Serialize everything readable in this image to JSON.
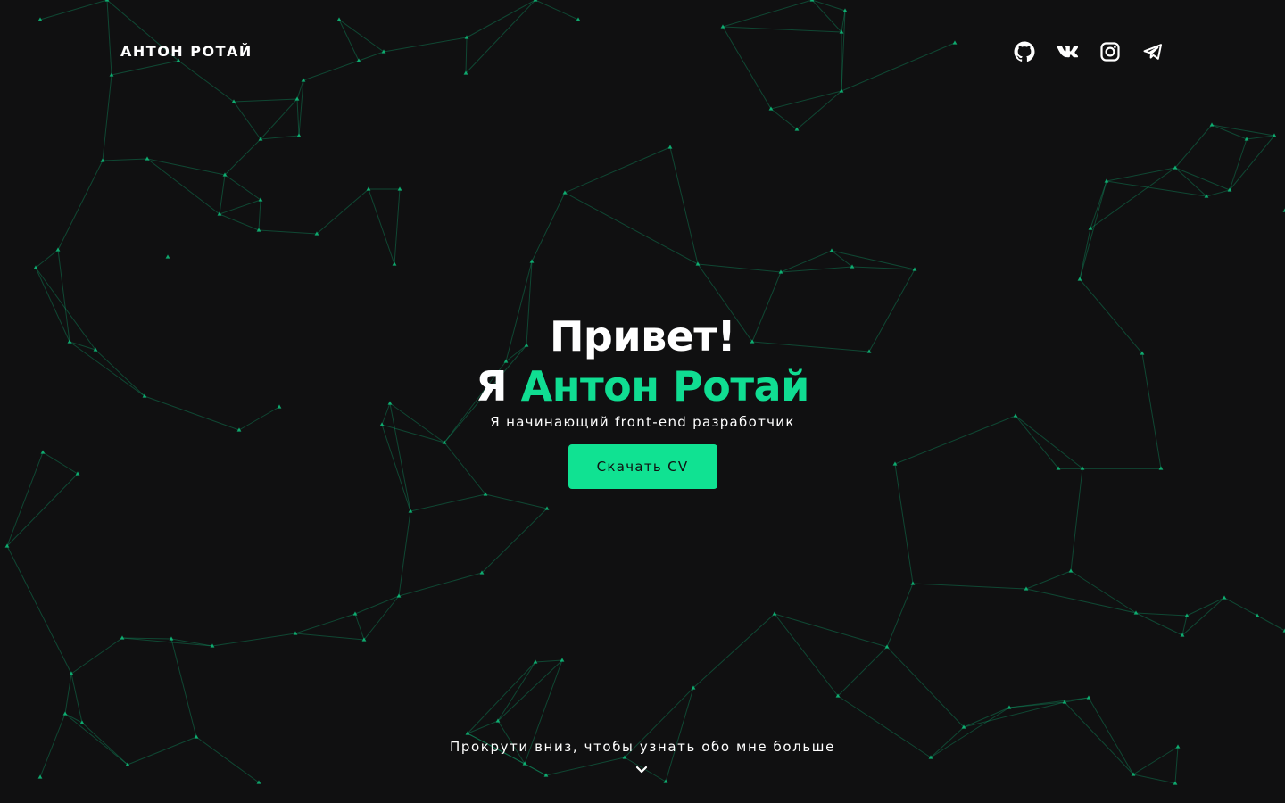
{
  "brand": {
    "name": "АНТОН РОТАЙ"
  },
  "social": [
    {
      "icon": "github-icon"
    },
    {
      "icon": "vk-icon"
    },
    {
      "icon": "instagram-icon"
    },
    {
      "icon": "telegram-icon"
    }
  ],
  "hero": {
    "greeting": "Привет!",
    "intro_prefix": "Я",
    "name": "Антон Ротай",
    "subtitle": "Я начинающий front-end разработчик",
    "cta_label": "Скачать CV"
  },
  "scroll_hint": {
    "text": "Прокрути вниз, чтобы узнать обо мне больше",
    "icon": "chevron-down-icon"
  },
  "colors": {
    "background": "#101011",
    "accent": "#10dd92",
    "network": "#0fbf7c"
  }
}
